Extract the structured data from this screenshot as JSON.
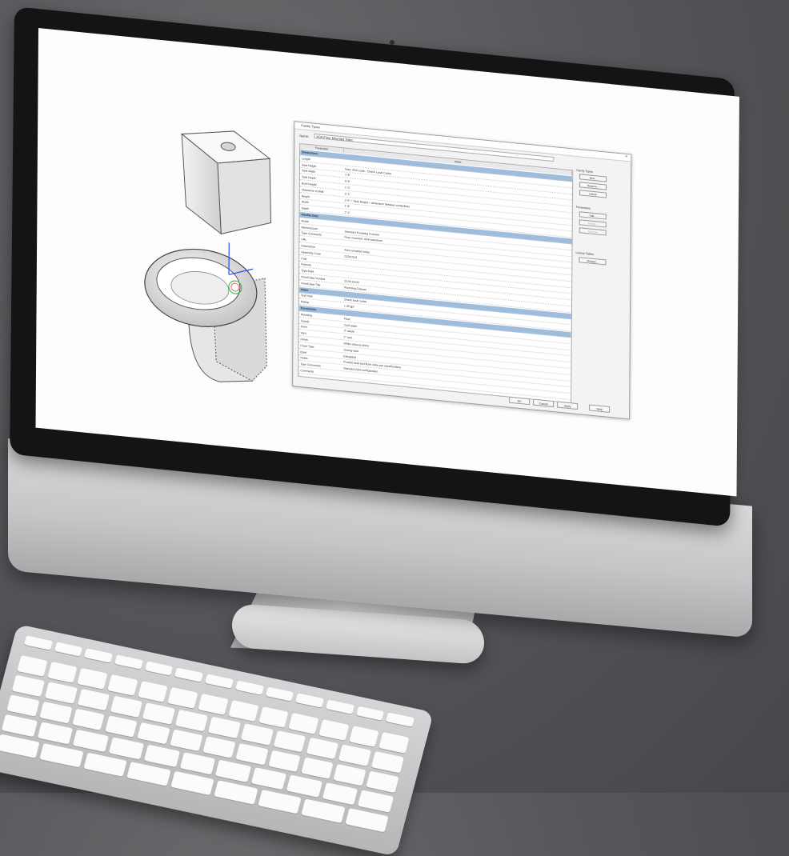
{
  "dialog": {
    "title": "Family Types",
    "types_label": "Name:",
    "type_name": "ADA Floor Mounted Toilet",
    "close": "×",
    "columns": [
      "Parameter",
      "Value"
    ],
    "rows": [
      {
        "group": "Dimensions"
      },
      {
        "p": "Length",
        "v": ""
      },
      {
        "p": "Seat Height",
        "v": "Note: ADA code - Check Local Codes"
      },
      {
        "p": "Tank Width",
        "v": "1' 8\""
      },
      {
        "p": "Tank Depth",
        "v": "0' 9\""
      },
      {
        "p": "Bowl Height",
        "v": "1' 5\""
      },
      {
        "p": "Clearance to Wall",
        "v": "0' 1\""
      },
      {
        "p": "Height",
        "v": "2' 6\"  = Tank Height + dimension between centerlines"
      },
      {
        "p": "Width",
        "v": "1' 8\""
      },
      {
        "p": "Depth",
        "v": "2' 4\""
      },
      {
        "group": "Identity Data"
      },
      {
        "p": "Model",
        "v": ""
      },
      {
        "p": "Manufacturer",
        "v": "Standard Plumbing Fixtures"
      },
      {
        "p": "Type Comments",
        "v": "Floor mounted, ADA compliant"
      },
      {
        "p": "URL",
        "v": ""
      },
      {
        "p": "Description",
        "v": "ADA compliant toilet"
      },
      {
        "p": "Assembly Code",
        "v": "D2010110"
      },
      {
        "p": "Cost",
        "v": ""
      },
      {
        "p": "Keynote",
        "v": ""
      },
      {
        "p": "Type Mark",
        "v": ""
      },
      {
        "p": "OmniClass Number",
        "v": "23.40.20.00"
      },
      {
        "p": "OmniClass Title",
        "v": "Plumbing Fixtures"
      },
      {
        "group": "Other"
      },
      {
        "p": "Text Note",
        "v": "Check local codes"
      },
      {
        "p": "Rating",
        "v": "1.28 gpf"
      },
      {
        "group": "Constraints"
      },
      {
        "p": "Mounting",
        "v": "Floor"
      },
      {
        "p": "Supply",
        "v": "Cold water"
      },
      {
        "p": "Drain",
        "v": "3\" waste"
      },
      {
        "p": "Vent",
        "v": "2\" vent"
      },
      {
        "p": "Finish",
        "v": "White vitreous china"
      },
      {
        "p": "Flush Type",
        "v": "Gravity tank"
      },
      {
        "p": "Bowl",
        "v": "Elongated"
      },
      {
        "p": "Notes",
        "v": "Provide seat and flush valve per specifications"
      },
      {
        "p": "Type Comments",
        "v": "Standard ADA configuration"
      },
      {
        "p": "Comments",
        "v": ""
      }
    ],
    "side": {
      "family_types_label": "Family Types",
      "new": "New...",
      "rename": "Rename...",
      "delete": "Delete",
      "parameters_label": "Parameters",
      "add": "Add...",
      "modify": "Modify...",
      "remove": "Remove",
      "lookup_label": "Lookup Tables",
      "manage": "Manage..."
    },
    "buttons": {
      "ok": "OK",
      "cancel": "Cancel",
      "apply": "Apply",
      "help": "Help"
    }
  },
  "colors": {
    "group_header": "#9ebcdb",
    "screen": "#fdfdfd",
    "bezel": "#141414"
  }
}
